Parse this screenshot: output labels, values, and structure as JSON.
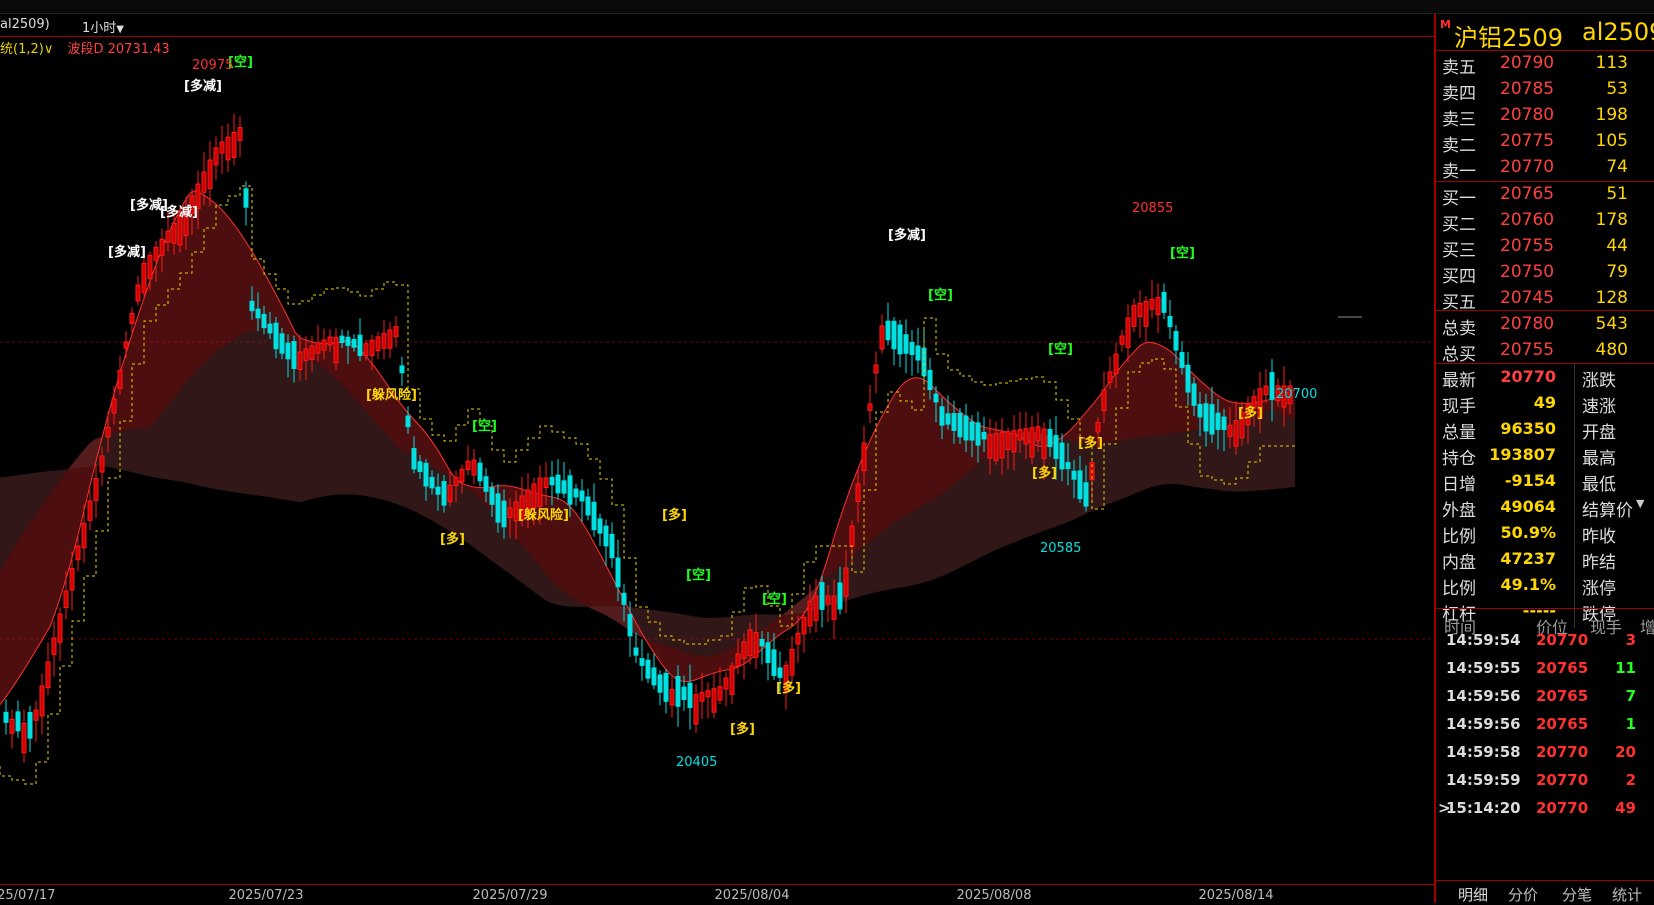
{
  "header": {
    "symbol": "al2509)",
    "period": "1小时",
    "indicator_name": "统(1,2)",
    "indicator_value": "波段D 20731.43"
  },
  "chart_data": {
    "type": "candlestick",
    "xlabel": "",
    "ylabel": "",
    "x_ticks": [
      "2025/07/17",
      "2025/07/23",
      "2025/07/29",
      "2025/08/04",
      "2025/08/08",
      "2025/08/14"
    ],
    "price_labels": [
      "20975",
      "20855",
      "20405",
      "20585",
      "20700"
    ],
    "annotations": [
      "[空]",
      "[多减]",
      "[多减]",
      "[多减]",
      "[多减]",
      "[躲风险]",
      "[空]",
      "[多]",
      "[躲风险]",
      "[多]",
      "[空]",
      "[空]",
      "[多]",
      "[多]",
      "[多减]",
      "[空]",
      "[空]",
      "[多]",
      "[多]",
      "[空]",
      "[多]"
    ],
    "colors": {
      "up": "#ff2020",
      "down": "#00e6e6",
      "signal_line": "#e6d200",
      "ma": "#ff3030"
    }
  },
  "quote": {
    "name": "沪铝2509",
    "code": "al2509",
    "asks": [
      {
        "label": "卖五",
        "price": "20790",
        "vol": "113"
      },
      {
        "label": "卖四",
        "price": "20785",
        "vol": "53"
      },
      {
        "label": "卖三",
        "price": "20780",
        "vol": "198"
      },
      {
        "label": "卖二",
        "price": "20775",
        "vol": "105"
      },
      {
        "label": "卖一",
        "price": "20770",
        "vol": "74"
      }
    ],
    "bids": [
      {
        "label": "买一",
        "price": "20765",
        "vol": "51"
      },
      {
        "label": "买二",
        "price": "20760",
        "vol": "178"
      },
      {
        "label": "买三",
        "price": "20755",
        "vol": "44"
      },
      {
        "label": "买四",
        "price": "20750",
        "vol": "79"
      },
      {
        "label": "买五",
        "price": "20745",
        "vol": "128"
      }
    ],
    "totals": [
      {
        "label": "总卖",
        "price": "20780",
        "vol": "543"
      },
      {
        "label": "总买",
        "price": "20755",
        "vol": "480"
      }
    ],
    "stats": [
      {
        "label": "最新",
        "value": "20770",
        "red": true,
        "label2": "涨跌"
      },
      {
        "label": "现手",
        "value": "49",
        "label2": "速涨"
      },
      {
        "label": "总量",
        "value": "96350",
        "label2": "开盘"
      },
      {
        "label": "持仓",
        "value": "193807",
        "label2": "最高"
      },
      {
        "label": "日增",
        "value": "-9154",
        "label2": "最低"
      },
      {
        "label": "外盘",
        "value": "49064",
        "label2": "结算价"
      },
      {
        "label": "比例",
        "value": "50.9%",
        "label2": "昨收"
      },
      {
        "label": "内盘",
        "value": "47237",
        "label2": "昨结"
      },
      {
        "label": "比例",
        "value": "49.1%",
        "label2": "涨停"
      },
      {
        "label": "杠杆",
        "value": "-----",
        "label2": "跌停"
      }
    ],
    "ticks_header": {
      "time": "时间",
      "price": "价位",
      "hand": "现手",
      "extra": "增"
    },
    "ticks": [
      {
        "time": "14:59:54",
        "price": "20770",
        "vol": "3",
        "color": "red"
      },
      {
        "time": "14:59:55",
        "price": "20765",
        "vol": "11",
        "color": "green"
      },
      {
        "time": "14:59:56",
        "price": "20765",
        "vol": "7",
        "color": "green"
      },
      {
        "time": "14:59:56",
        "price": "20765",
        "vol": "1",
        "color": "green"
      },
      {
        "time": "14:59:58",
        "price": "20770",
        "vol": "20",
        "color": "red"
      },
      {
        "time": "14:59:59",
        "price": "20770",
        "vol": "2",
        "color": "red"
      },
      {
        "time": "15:14:20",
        "price": "20770",
        "vol": "49",
        "color": "red"
      }
    ],
    "tabs": [
      "明细",
      "分价",
      "分笔",
      "统计"
    ]
  }
}
